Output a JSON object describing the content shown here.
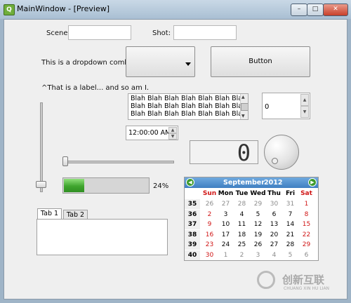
{
  "window": {
    "title": "MainWindow - [Preview]",
    "app_icon": "qt-designer-icon",
    "minimize_glyph": "–",
    "maximize_glyph": "□",
    "close_glyph": "✕"
  },
  "form": {
    "scene_label": "Scene:",
    "scene_value": "",
    "shot_label": "Shot:",
    "shot_value": ""
  },
  "combo": {
    "label": "This is a dropdown combo =>",
    "selected": ""
  },
  "push_button": {
    "label": "Button"
  },
  "caption_label": "^That is a label... and so am I.",
  "text_edit": {
    "lines": [
      "Blah Blah Blah Blah Blah Blah Blah Blah",
      "Blah Blah Blah Blah Blah Blah Blah Blah",
      "Blah Blah Blah Blah Blah Blah Blah Blah"
    ]
  },
  "spinbox": {
    "value": "0"
  },
  "time_edit": {
    "value": "12:00:00 AM"
  },
  "lcd": {
    "value": "0"
  },
  "progress": {
    "text": "24%",
    "fraction": 0.24
  },
  "tabs": [
    {
      "label": "Tab 1",
      "active": true
    },
    {
      "label": "Tab 2",
      "active": false
    }
  ],
  "calendar": {
    "month": "September",
    "year": "2012",
    "day_headers": [
      "Sun",
      "Mon",
      "Tue",
      "Wed",
      "Thu",
      "Fri",
      "Sat"
    ],
    "weeks": [
      {
        "wn": "35",
        "days": [
          {
            "d": "26",
            "dim": true
          },
          {
            "d": "27",
            "dim": true
          },
          {
            "d": "28",
            "dim": true
          },
          {
            "d": "29",
            "dim": true
          },
          {
            "d": "30",
            "dim": true
          },
          {
            "d": "31",
            "dim": true
          },
          {
            "d": "1"
          }
        ]
      },
      {
        "wn": "36",
        "days": [
          {
            "d": "2"
          },
          {
            "d": "3"
          },
          {
            "d": "4"
          },
          {
            "d": "5"
          },
          {
            "d": "6"
          },
          {
            "d": "7"
          },
          {
            "d": "8"
          }
        ]
      },
      {
        "wn": "37",
        "days": [
          {
            "d": "9"
          },
          {
            "d": "10"
          },
          {
            "d": "11"
          },
          {
            "d": "12"
          },
          {
            "d": "13"
          },
          {
            "d": "14"
          },
          {
            "d": "15"
          }
        ]
      },
      {
        "wn": "38",
        "days": [
          {
            "d": "16"
          },
          {
            "d": "17"
          },
          {
            "d": "18"
          },
          {
            "d": "19"
          },
          {
            "d": "20"
          },
          {
            "d": "21"
          },
          {
            "d": "22"
          }
        ]
      },
      {
        "wn": "39",
        "days": [
          {
            "d": "23"
          },
          {
            "d": "24"
          },
          {
            "d": "25"
          },
          {
            "d": "26"
          },
          {
            "d": "27"
          },
          {
            "d": "28"
          },
          {
            "d": "29"
          }
        ]
      },
      {
        "wn": "40",
        "days": [
          {
            "d": "30"
          },
          {
            "d": "1",
            "dim": true
          },
          {
            "d": "2",
            "dim": true
          },
          {
            "d": "3",
            "dim": true
          },
          {
            "d": "4",
            "dim": true
          },
          {
            "d": "5",
            "dim": true
          },
          {
            "d": "6",
            "dim": true
          }
        ]
      }
    ]
  },
  "watermark": {
    "text": "创新互联",
    "subtext": "CHUANG XIN HU LIAN"
  },
  "colors": {
    "calendar_header": "#3f7fc1",
    "weekend": "#d01515",
    "progress": "#3fa52e"
  }
}
